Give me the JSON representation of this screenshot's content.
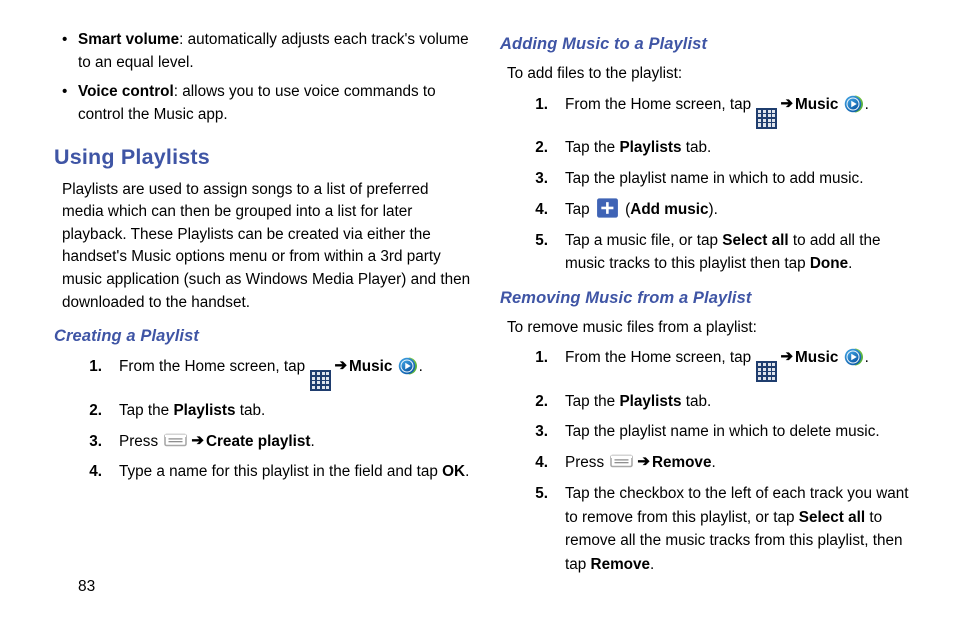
{
  "page": {
    "number": "83"
  },
  "left_column": {
    "bullets": [
      {
        "term": "Smart volume",
        "sep": ": ",
        "text": "automatically adjusts each track's volume to an equal level."
      },
      {
        "term": "Voice control",
        "sep": ": ",
        "text": "allows you to use voice commands to control the Music app."
      }
    ],
    "heading": "Using Playlists",
    "intro": "Playlists are used to assign songs to a list of preferred media which can then be grouped into a list for later playback. These Playlists can be created via either the handset's Music options menu or from within a 3rd party music application (such as Windows Media Player) and then downloaded to the handset.",
    "subheading": "Creating a Playlist",
    "steps": [
      {
        "num": "1.",
        "part1": "From the Home screen, tap ",
        "icon1": "apps-grid-icon",
        "arrow": "➔",
        "bold1": "Music",
        "icon2": "music-app-icon",
        "part2": "."
      },
      {
        "num": "2.",
        "part1": "Tap the ",
        "bold1": "Playlists",
        "part2": " tab."
      },
      {
        "num": "3.",
        "part1": "Press ",
        "icon1": "menu-key-icon",
        "arrow": "➔",
        "bold1": "Create playlist",
        "part2": "."
      },
      {
        "num": "4.",
        "part1": "Type a name for this playlist in the field and tap ",
        "bold1": "OK",
        "part2": "."
      }
    ]
  },
  "right_column": {
    "section1": {
      "subheading": "Adding Music to a Playlist",
      "lead": "To add files to the playlist:",
      "steps": [
        {
          "num": "1.",
          "part1": "From the Home screen, tap ",
          "icon1": "apps-grid-icon",
          "arrow": "➔",
          "bold1": "Music",
          "icon2": "music-app-icon",
          "part2": "."
        },
        {
          "num": "2.",
          "part1": "Tap the ",
          "bold1": "Playlists",
          "part2": " tab."
        },
        {
          "num": "3.",
          "part1": "Tap the playlist name in which to add music."
        },
        {
          "num": "4.",
          "part1": "Tap ",
          "icon1": "plus-add-music-button",
          "part2": " (",
          "bold1": "Add music",
          "part3": ")."
        },
        {
          "num": "5.",
          "part1": "Tap a music file, or tap ",
          "bold1": "Select all",
          "part2": " to add all the music tracks to this playlist then tap ",
          "bold2": "Done",
          "part3": "."
        }
      ]
    },
    "section2": {
      "subheading": "Removing Music from a Playlist",
      "lead": "To remove music files from a playlist:",
      "steps": [
        {
          "num": "1.",
          "part1": "From the Home screen, tap ",
          "icon1": "apps-grid-icon",
          "arrow": "➔",
          "bold1": "Music",
          "icon2": "music-app-icon",
          "part2": "."
        },
        {
          "num": "2.",
          "part1": "Tap the ",
          "bold1": "Playlists",
          "part2": " tab."
        },
        {
          "num": "3.",
          "part1": "Tap the playlist name in which to delete music."
        },
        {
          "num": "4.",
          "part1": "Press ",
          "icon1": "menu-key-icon",
          "arrow": "➔",
          "bold1": "Remove",
          "part2": "."
        },
        {
          "num": "5.",
          "part1": "Tap the checkbox to the left of each track you want to remove from this playlist, or tap ",
          "bold1": "Select all",
          "part2": " to remove all the music tracks from this playlist, then tap ",
          "bold2": "Remove",
          "part3": "."
        }
      ]
    }
  },
  "colors": {
    "heading_blue": "#3f55a5",
    "apps_icon_navy": "#1f3d6e",
    "apps_icon_cell": "#dfe4ec",
    "music_icon_blue": "#1878c8",
    "music_icon_green": "#79c143",
    "plus_button_blue": "#3f63b5",
    "menu_key_gray": "#9a9a9a"
  }
}
